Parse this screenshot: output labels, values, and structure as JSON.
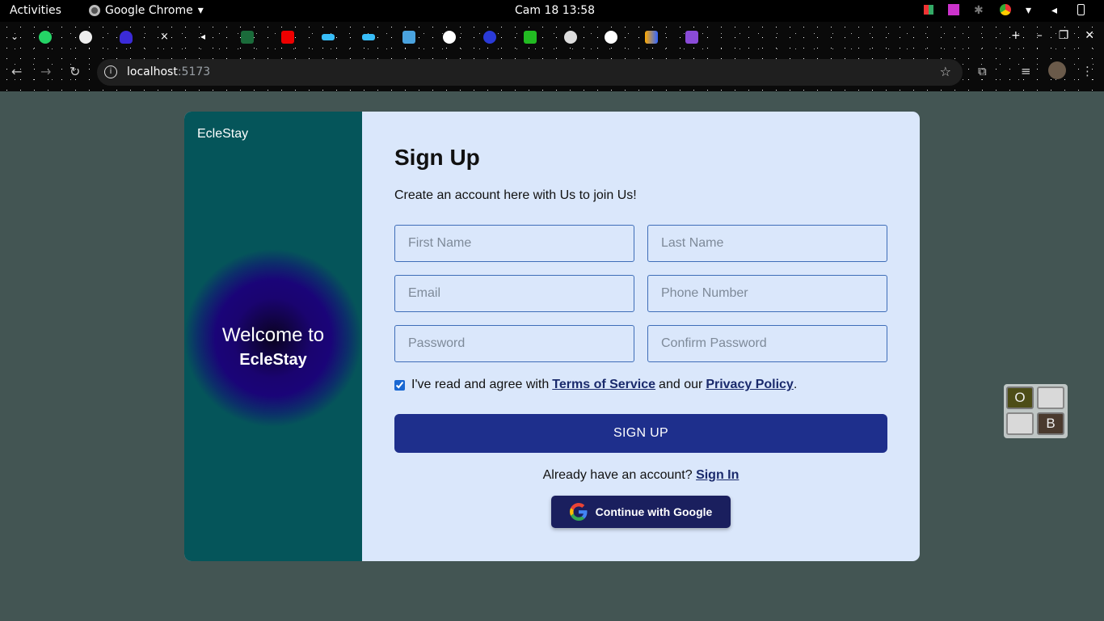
{
  "topbar": {
    "activities": "Activities",
    "app_name": "Google Chrome",
    "clock": "Cam 18  13:58"
  },
  "browser": {
    "url_host": "localhost",
    "url_port": ":5173"
  },
  "hero": {
    "brand": "EcleStay",
    "welcome_line1": "Welcome to",
    "welcome_line2": "EcleStay"
  },
  "form": {
    "title": "Sign Up",
    "subtitle": "Create an account here with Us to join Us!",
    "first_name_placeholder": "First Name",
    "last_name_placeholder": "Last Name",
    "email_placeholder": "Email",
    "phone_placeholder": "Phone Number",
    "password_placeholder": "Password",
    "confirm_password_placeholder": "Confirm Password",
    "agree_prefix": "I've read and agree with",
    "terms_link": "Terms of Service",
    "agree_middle": "and our",
    "privacy_link": "Privacy Policy",
    "agree_suffix": ".",
    "signup_button": "SIGN UP",
    "already_text": "Already have an account?",
    "signin_link": "Sign In",
    "google_button": "Continue with Google"
  },
  "widget": {
    "top_left": "O",
    "bottom_right": "B"
  }
}
